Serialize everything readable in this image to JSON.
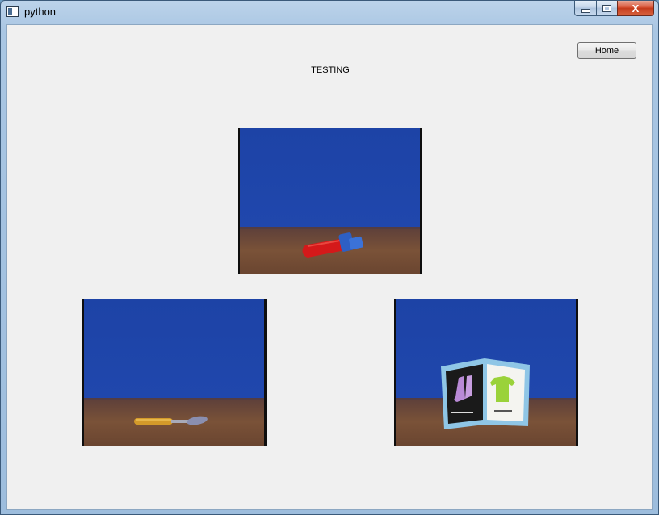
{
  "window": {
    "title": "python",
    "icon": "python-window-icon",
    "controls": [
      "minimize-icon",
      "maximize-icon",
      "close-icon"
    ],
    "close_glyph": "X"
  },
  "toolbar": {
    "home_label": "Home"
  },
  "main": {
    "heading": "TESTING"
  },
  "stimuli": [
    {
      "name": "hammer",
      "icon": "toy-hammer"
    },
    {
      "name": "spoon",
      "icon": "spoon"
    },
    {
      "name": "book",
      "icon": "picture-book"
    }
  ],
  "colors": {
    "backdrop_blue": "#1f45a8",
    "table_brown": "#6e4a38",
    "client_bg": "#f0f0f0"
  }
}
